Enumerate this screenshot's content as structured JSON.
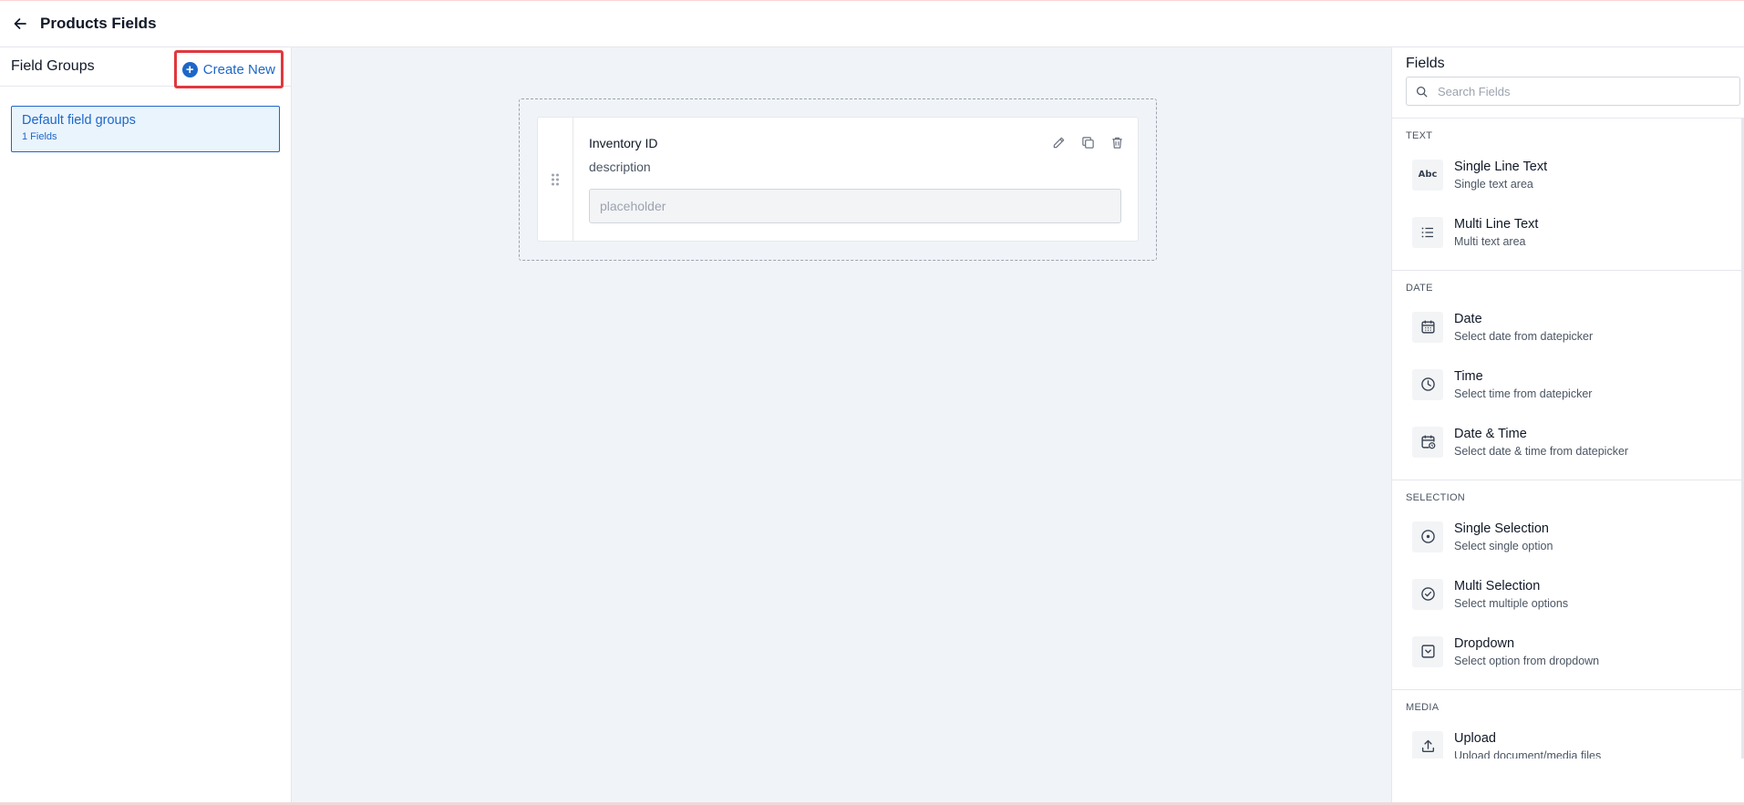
{
  "header": {
    "title": "Products Fields"
  },
  "left_panel": {
    "title": "Field Groups",
    "create_label": "Create New",
    "groups": [
      {
        "name": "Default field groups",
        "count": "1 Fields"
      }
    ]
  },
  "canvas": {
    "field": {
      "label": "Inventory ID",
      "description": "description",
      "placeholder": "placeholder"
    }
  },
  "right_panel": {
    "title": "Fields",
    "search_placeholder": "Search Fields",
    "sections": [
      {
        "title": "TEXT",
        "items": [
          {
            "name": "Single Line Text",
            "desc": "Single text area",
            "icon": "abc-icon"
          },
          {
            "name": "Multi Line Text",
            "desc": "Multi text area",
            "icon": "list-icon"
          }
        ]
      },
      {
        "title": "DATE",
        "items": [
          {
            "name": "Date",
            "desc": "Select date from datepicker",
            "icon": "calendar-icon"
          },
          {
            "name": "Time",
            "desc": "Select time from datepicker",
            "icon": "clock-icon"
          },
          {
            "name": "Date & Time",
            "desc": "Select date & time from datepicker",
            "icon": "calendar-clock-icon"
          }
        ]
      },
      {
        "title": "SELECTION",
        "items": [
          {
            "name": "Single Selection",
            "desc": "Select single option",
            "icon": "radio-icon"
          },
          {
            "name": "Multi Selection",
            "desc": "Select multiple options",
            "icon": "check-circle-icon"
          },
          {
            "name": "Dropdown",
            "desc": "Select option from dropdown",
            "icon": "dropdown-icon"
          }
        ]
      },
      {
        "title": "MEDIA",
        "items": [
          {
            "name": "Upload",
            "desc": "Upload document/media files",
            "icon": "upload-icon"
          }
        ]
      }
    ]
  },
  "colors": {
    "accent": "#1d67c9",
    "highlight": "#e0383e",
    "canvas_bg": "#f0f4f8"
  }
}
